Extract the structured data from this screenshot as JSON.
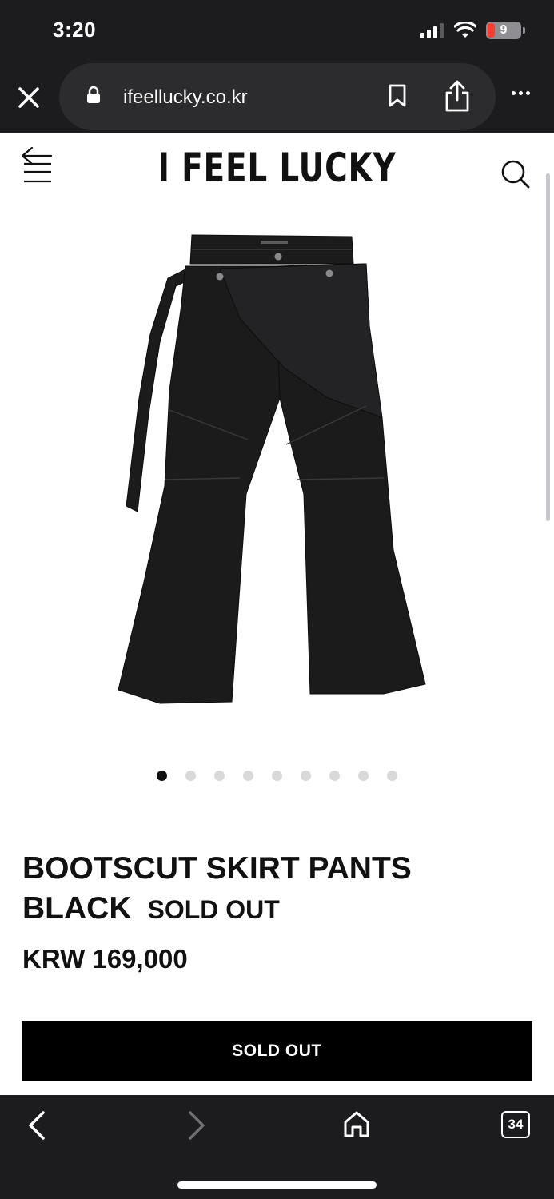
{
  "status_bar": {
    "time": "3:20",
    "battery_level": "9"
  },
  "browser": {
    "url": "ifeellucky.co.kr",
    "tab_count": "34"
  },
  "site": {
    "logo": "I FEEL LUCKY"
  },
  "gallery": {
    "total_images": 9,
    "active_index": 0
  },
  "product": {
    "title_line1": "BOOTSCUT SKIRT PANTS",
    "title_line2": "BLACK",
    "status": "SOLD OUT",
    "price": "KRW 169,000",
    "button_label": "SOLD OUT"
  },
  "colors": {
    "browser_chrome": "#1c1c1e",
    "url_pill": "#2c2c2e",
    "button_bg": "#000000",
    "battery_low": "#ff3b30"
  }
}
